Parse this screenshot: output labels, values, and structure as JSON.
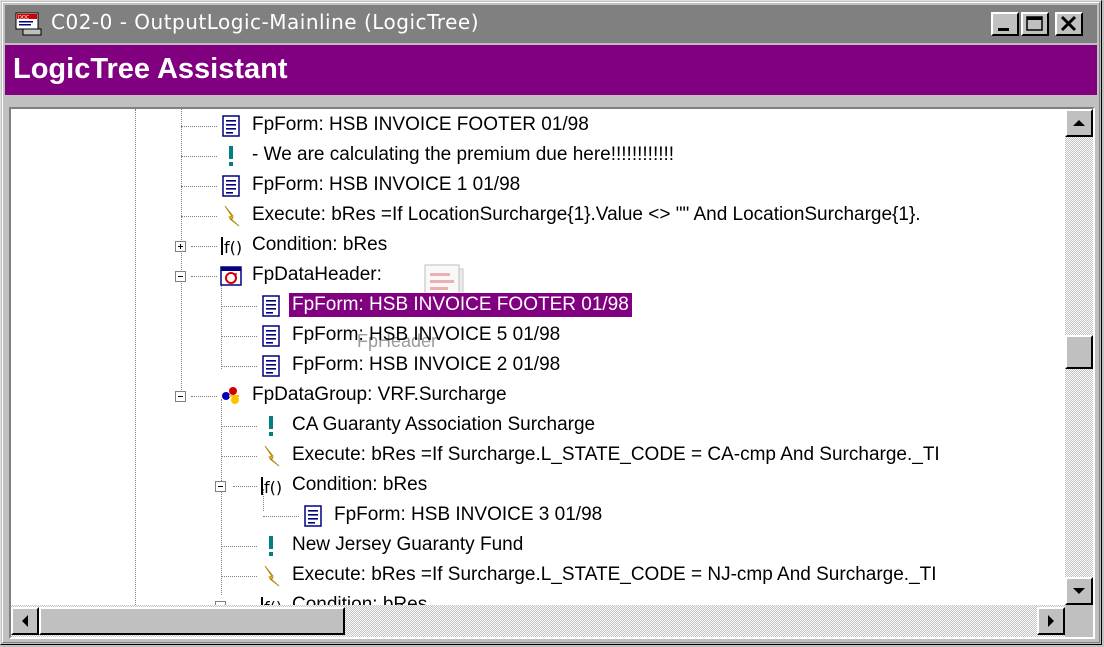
{
  "window": {
    "title": "C02-0 - OutputLogic-Mainline (LogicTree)",
    "controls": [
      "minimize",
      "maximize",
      "close"
    ]
  },
  "assistant": {
    "title": "LogicTree Assistant"
  },
  "tree": {
    "items": [
      {
        "label": "FpForm: HSB INVOICE FOOTER 01/98",
        "icon": "form-icon"
      },
      {
        "label": "- We are calculating the premium due here!!!!!!!!!!!!",
        "icon": "comment-icon"
      },
      {
        "label": "FpForm: HSB INVOICE 1 01/98",
        "icon": "form-icon"
      },
      {
        "label": "Execute: bRes =If LocationSurcharge{1}.Value <> \"\" And LocationSurcharge{1}.",
        "icon": "execute-icon"
      },
      {
        "label": "Condition: bRes",
        "icon": "condition-icon",
        "expander": "plus"
      },
      {
        "label": "FpDataHeader:",
        "icon": "data-header-icon",
        "expander": "minus"
      },
      {
        "label": "FpForm: HSB INVOICE FOOTER 01/98",
        "icon": "form-icon",
        "selected": true
      },
      {
        "label": "FpForm: HSB INVOICE 5 01/98",
        "icon": "form-icon"
      },
      {
        "label": "FpForm: HSB INVOICE 2 01/98",
        "icon": "form-icon"
      },
      {
        "label": "FpDataGroup: VRF.Surcharge",
        "icon": "data-group-icon",
        "expander": "minus"
      },
      {
        "label": "CA Guaranty Association Surcharge",
        "icon": "comment-icon"
      },
      {
        "label": "Execute: bRes =If Surcharge.L_STATE_CODE = CA-cmp And Surcharge._TI",
        "icon": "execute-icon"
      },
      {
        "label": "Condition: bRes",
        "icon": "condition-icon",
        "expander": "minus"
      },
      {
        "label": "FpForm: HSB INVOICE 3 01/98",
        "icon": "form-icon"
      },
      {
        "label": "New Jersey Guaranty Fund",
        "icon": "comment-icon"
      },
      {
        "label": "Execute: bRes =If Surcharge.L_STATE_CODE = NJ-cmp And Surcharge._TI",
        "icon": "execute-icon"
      },
      {
        "label": "Condition: bRes",
        "icon": "condition-icon",
        "expander": "minus"
      }
    ],
    "drag_ghost": {
      "label": "FpHeader",
      "icon": "document-drag-icon"
    }
  },
  "colors": {
    "accent": "#800080",
    "title_bar": "#808080",
    "face": "#c0c0c0"
  }
}
